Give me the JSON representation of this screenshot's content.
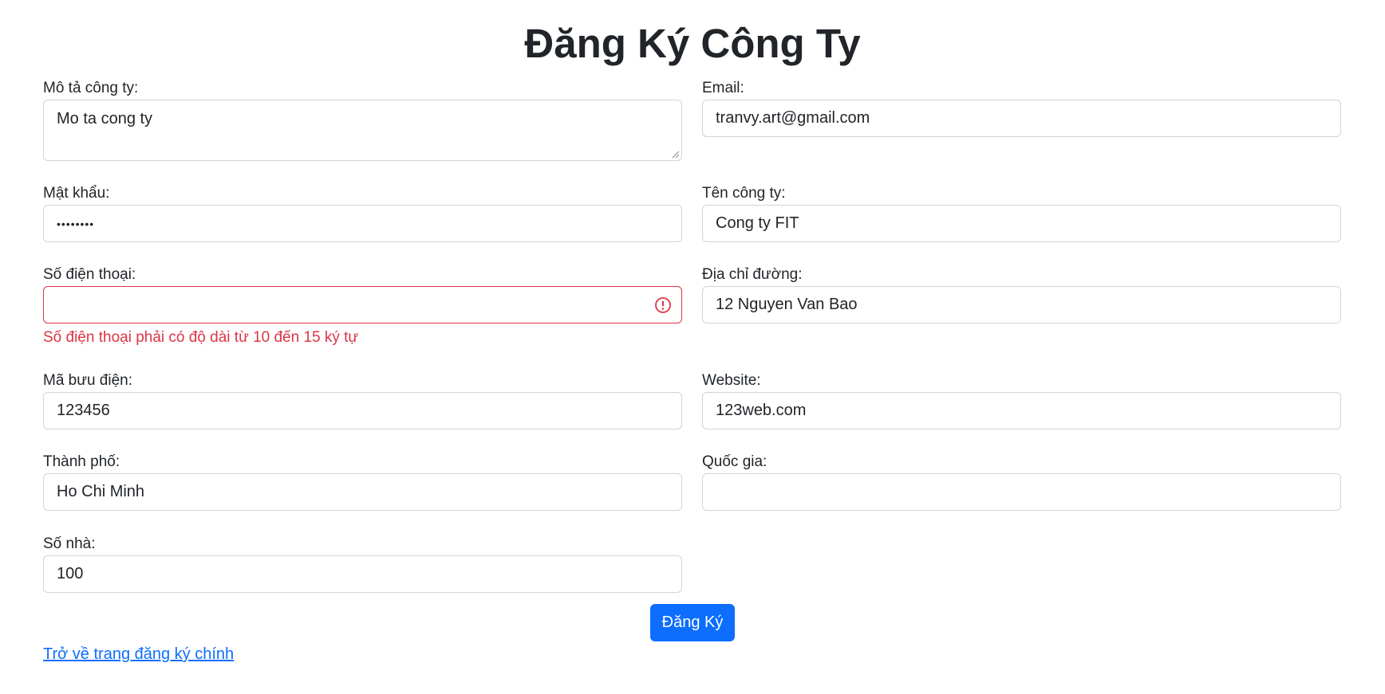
{
  "page": {
    "title": "Đăng Ký Công Ty"
  },
  "form": {
    "description": {
      "label": "Mô tả công ty:",
      "value": "Mo ta cong ty"
    },
    "email": {
      "label": "Email:",
      "value": "tranvy.art@gmail.com"
    },
    "password": {
      "label": "Mật khẩu:",
      "value": "••••••••"
    },
    "company_name": {
      "label": "Tên công ty:",
      "value": "Cong ty FIT"
    },
    "phone": {
      "label": "Số điện thoại:",
      "value": "",
      "error": "Số điện thoại phải có độ dài từ 10 đến 15 ký tự"
    },
    "street_address": {
      "label": "Địa chỉ đường:",
      "value": "12 Nguyen Van Bao"
    },
    "postal_code": {
      "label": "Mã bưu điện:",
      "value": "123456"
    },
    "website": {
      "label": "Website:",
      "value": "123web.com"
    },
    "city": {
      "label": "Thành phố:",
      "value": "Ho Chi Minh"
    },
    "country": {
      "label": "Quốc gia:",
      "value": ""
    },
    "house_number": {
      "label": "Số nhà:",
      "value": "100"
    }
  },
  "actions": {
    "submit_label": "Đăng Ký",
    "back_link_label": "Trở về trang đăng ký chính"
  },
  "colors": {
    "primary": "#0d6efd",
    "danger": "#dc3545",
    "border": "#ced4da",
    "text": "#212529"
  },
  "icons": {
    "phone_invalid": "exclamation-circle-icon",
    "textarea_resize": "resize-grip-icon"
  }
}
